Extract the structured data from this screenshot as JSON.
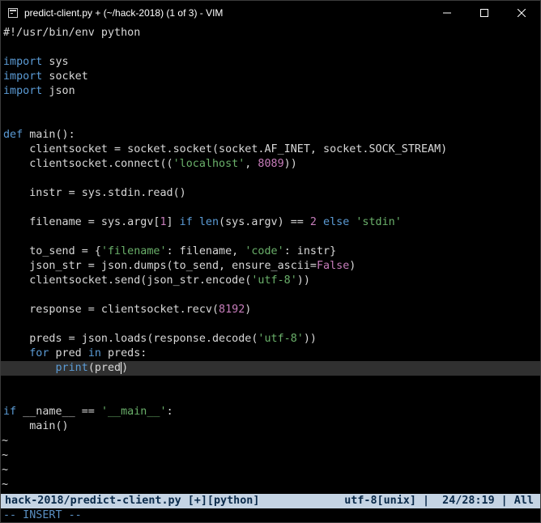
{
  "window": {
    "title": "predict-client.py + (~/hack-2018) (1 of 3) - VIM"
  },
  "colors": {
    "keyword": "#5b9bd5",
    "string": "#6ab06a",
    "number": "#c77dbb",
    "statusline_bg": "#c5d4e4",
    "cursorline_bg": "#303030"
  },
  "code": {
    "l1": "#!/usr/bin/env python",
    "l3_kw": "import",
    "l3_rest": " sys",
    "l4_kw": "import",
    "l4_rest": " socket",
    "l5_kw": "import",
    "l5_rest": " json",
    "l8_kw": "def",
    "l8_rest": " main():",
    "l9": "    clientsocket = socket.socket(socket.AF_INET, socket.SOCK_STREAM)",
    "l10_a": "    clientsocket.connect((",
    "l10_str": "'localhost'",
    "l10_b": ", ",
    "l10_num": "8089",
    "l10_c": "))",
    "l12": "    instr = sys.stdin.read()",
    "l14_a": "    filename = sys.argv[",
    "l14_num1": "1",
    "l14_b": "] ",
    "l14_kw1": "if",
    "l14_c": " ",
    "l14_kw2": "len",
    "l14_d": "(sys.argv) == ",
    "l14_num2": "2",
    "l14_e": " ",
    "l14_kw3": "else",
    "l14_f": " ",
    "l14_str": "'stdin'",
    "l16_a": "    to_send = {",
    "l16_str1": "'filename'",
    "l16_b": ": filename, ",
    "l16_str2": "'code'",
    "l16_c": ": instr}",
    "l17_a": "    json_str = json.dumps(to_send, ensure_ascii=",
    "l17_kw": "False",
    "l17_b": ")",
    "l18_a": "    clientsocket.send(json_str.encode(",
    "l18_str": "'utf-8'",
    "l18_b": "))",
    "l20_a": "    response = clientsocket.recv(",
    "l20_num": "8192",
    "l20_b": ")",
    "l22_a": "    preds = json.loads(response.decode(",
    "l22_str": "'utf-8'",
    "l22_b": "))",
    "l23_pre": "    ",
    "l23_kw1": "for",
    "l23_a": " pred ",
    "l23_kw2": "in",
    "l23_b": " preds:",
    "l24_pre": "        ",
    "l24_kw": "print",
    "l24_a": "(pred",
    "l24_b": ")",
    "l27_kw": "if",
    "l27_a": " __name__ == ",
    "l27_str": "'__main__'",
    "l27_b": ":",
    "l28": "    main()",
    "tilde": "~"
  },
  "statusline": {
    "left": "hack-2018/predict-client.py [+][python]",
    "right": "utf-8[unix] |  24/28:19 | All"
  },
  "mode": "-- INSERT --"
}
